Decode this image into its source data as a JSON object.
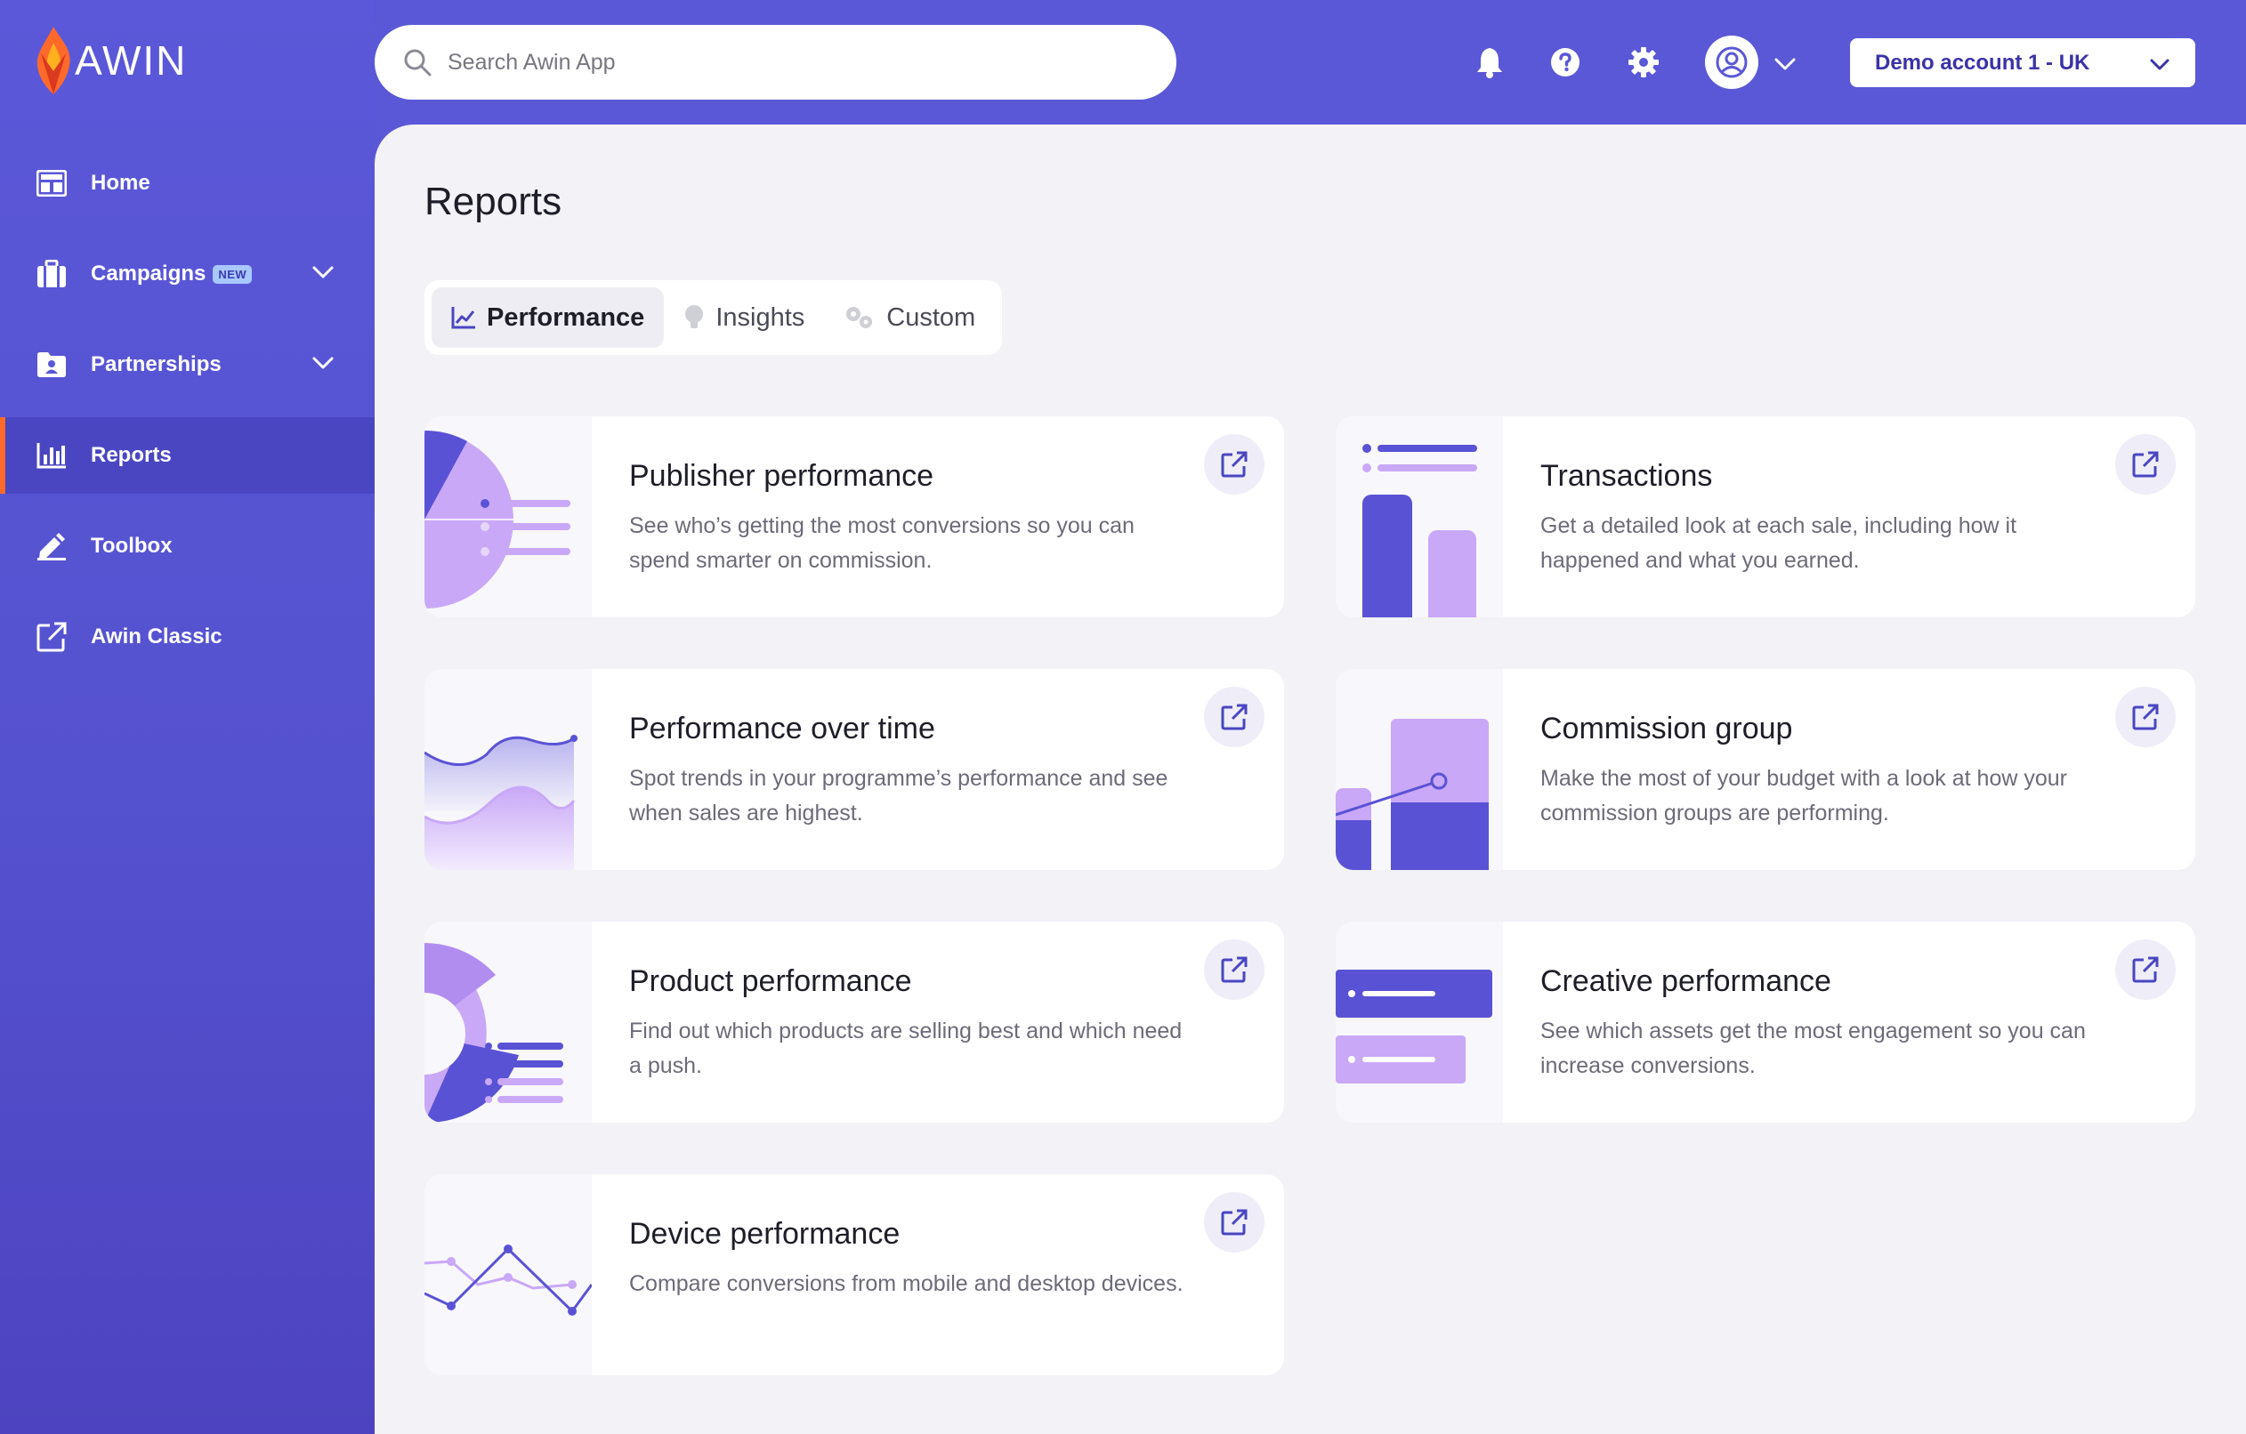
{
  "app": {
    "name": "AWIN"
  },
  "search": {
    "placeholder": "Search Awin App"
  },
  "header": {
    "account_label": "Demo account 1 - UK"
  },
  "sidebar": {
    "items": [
      {
        "label": "Home",
        "icon": "dashboard-icon"
      },
      {
        "label": "Campaigns",
        "icon": "briefcase-icon",
        "badge": "NEW"
      },
      {
        "label": "Partnerships",
        "icon": "folder-user-icon"
      },
      {
        "label": "Reports",
        "icon": "bar-chart-icon"
      },
      {
        "label": "Toolbox",
        "icon": "pen-icon"
      },
      {
        "label": "Awin Classic",
        "icon": "external-link-icon"
      }
    ]
  },
  "page": {
    "title": "Reports"
  },
  "tabs": [
    {
      "label": "Performance",
      "icon": "line-chart-icon"
    },
    {
      "label": "Insights",
      "icon": "lightbulb-icon"
    },
    {
      "label": "Custom",
      "icon": "gears-icon"
    }
  ],
  "cards": [
    {
      "title": "Publisher performance",
      "desc": "See who’s getting the most conversions so you can spend smarter on commission."
    },
    {
      "title": "Transactions",
      "desc": "Get a detailed look at each sale, including how it happened and what you earned."
    },
    {
      "title": "Performance over time",
      "desc": "Spot trends in your programme’s performance and see when sales are highest."
    },
    {
      "title": "Commission group",
      "desc": "Make the most of your budget with a look at how your commission groups are performing."
    },
    {
      "title": "Product performance",
      "desc": "Find out which products are selling best and which need a push."
    },
    {
      "title": "Creative performance",
      "desc": "See which assets get the most engagement so you can increase conversions."
    },
    {
      "title": "Device performance",
      "desc": "Compare conversions from mobile and desktop devices."
    }
  ],
  "colors": {
    "brand": "#5a58d6",
    "active_nav": "#4a46c2",
    "accent": "#ff6a2b",
    "illustration_dark": "#5a52d5",
    "illustration_light": "#c9a8f7"
  }
}
